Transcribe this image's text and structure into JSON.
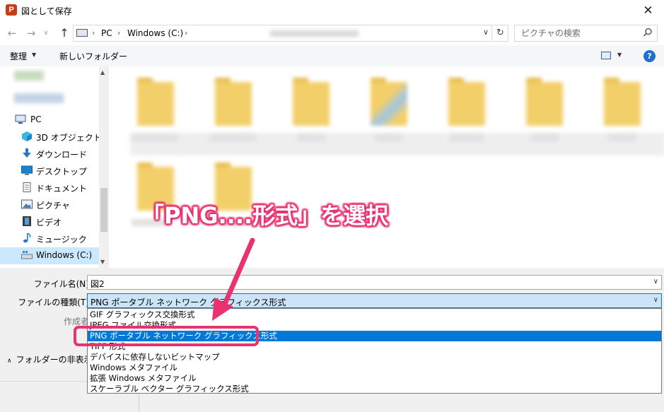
{
  "window": {
    "title": "図として保存",
    "app_icon_letter": "P"
  },
  "address": {
    "crumbs": [
      "PC",
      "Windows (C:)"
    ],
    "search_placeholder": "ピクチャの検索"
  },
  "toolbar": {
    "organize_label": "整理",
    "new_folder_label": "新しいフォルダー"
  },
  "nav": {
    "items": [
      {
        "name": "pc",
        "label": "PC"
      },
      {
        "name": "3d",
        "label": "3D オブジェクト"
      },
      {
        "name": "downloads",
        "label": "ダウンロード"
      },
      {
        "name": "desktop",
        "label": "デスクトップ"
      },
      {
        "name": "documents",
        "label": "ドキュメント"
      },
      {
        "name": "pictures",
        "label": "ピクチャ"
      },
      {
        "name": "videos",
        "label": "ビデオ"
      },
      {
        "name": "music",
        "label": "ミュージック"
      },
      {
        "name": "windows-c",
        "label": "Windows (C:)"
      }
    ]
  },
  "form": {
    "filename_label": "ファイル名(N):",
    "filename_value": "図2",
    "filetype_label": "ファイルの種類(T):",
    "filetype_value": "PNG ポータブル ネットワーク グラフィックス形式",
    "author_label": "作成者:",
    "hide_folders_label": "フォルダーの非表示"
  },
  "dropdown": {
    "options": [
      "GIF グラフィックス交換形式",
      "JPEG ファイル交換形式",
      "PNG ポータブル ネットワーク グラフィックス形式",
      "TIFF 形式",
      "デバイスに依存しないビットマップ",
      "Windows メタファイル",
      "拡張 Windows メタファイル",
      "スケーラブル ベクター グラフィックス形式"
    ],
    "selected_index": 2
  },
  "annotation": {
    "text": "「PNG....形式」を選択",
    "color": "#e8336f"
  },
  "colors": {
    "selection": "#0078d7",
    "nav_selected": "#cce8ff",
    "folder": "#f3cf69"
  }
}
